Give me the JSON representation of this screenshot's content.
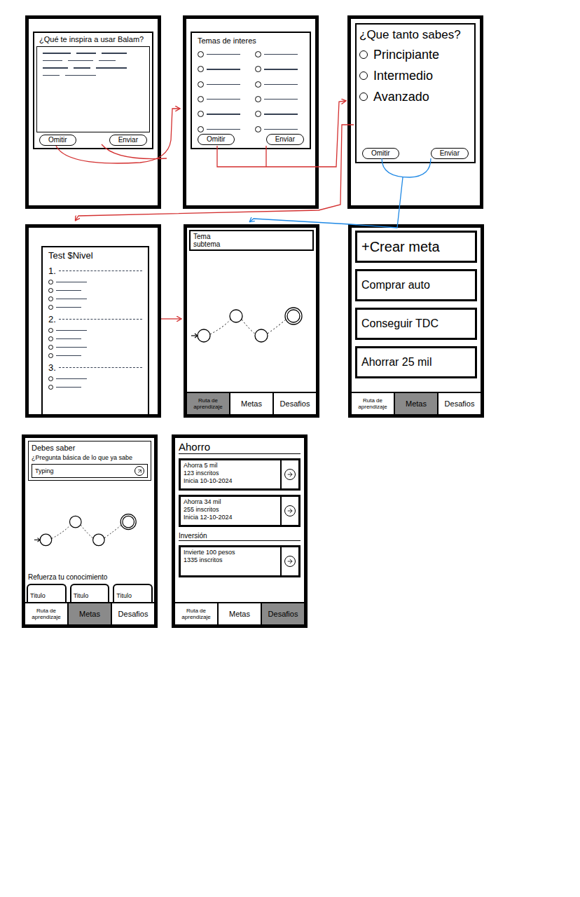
{
  "screens": [
    {
      "kind": "inspiration",
      "title": "¿Qué te inspira a usar Balam?",
      "buttons": [
        "Omitir",
        "Enviar"
      ]
    },
    {
      "kind": "topics",
      "title": "Temas de interes",
      "options": [
        {
          "selected": false
        },
        {
          "selected": false
        },
        {
          "selected": false
        },
        {
          "selected": false
        },
        {
          "selected": false
        },
        {
          "selected": false
        },
        {
          "selected": false
        },
        {
          "selected": false
        },
        {
          "selected": false
        },
        {
          "selected": false
        },
        {
          "selected": false
        },
        {
          "selected": false
        }
      ],
      "buttons": [
        "Omitir",
        "Enviar"
      ]
    },
    {
      "kind": "level",
      "title": "¿Que tanto sabes?",
      "options": [
        {
          "label": "Principiante",
          "selected": false
        },
        {
          "label": "Intermedio",
          "selected": false
        },
        {
          "label": "Avanzado",
          "selected": false
        }
      ],
      "buttons": [
        "Omitir",
        "Enviar"
      ]
    },
    {
      "kind": "test",
      "title": "Test $Nivel",
      "questions": [
        {
          "number": "1.",
          "options": [
            {
              "selected": false
            },
            {
              "selected": false
            },
            {
              "selected": false
            },
            {
              "selected": false
            }
          ]
        },
        {
          "number": "2.",
          "options": [
            {
              "selected": false
            },
            {
              "selected": false
            },
            {
              "selected": false
            },
            {
              "selected": false
            }
          ]
        },
        {
          "number": "3.",
          "options": [
            {
              "selected": false
            },
            {
              "selected": false
            }
          ]
        }
      ]
    },
    {
      "kind": "path",
      "header": {
        "title": "Tema",
        "subtitle": "subtema"
      },
      "nodes": [
        {
          "current": false
        },
        {
          "current": false
        },
        {
          "current": false
        },
        {
          "current": true
        }
      ],
      "tabs": [
        {
          "label": "Ruta de aprendizaje",
          "selected": true
        },
        {
          "label": "Metas",
          "selected": false
        },
        {
          "label": "Desafios",
          "selected": false
        }
      ]
    },
    {
      "kind": "goals",
      "items": [
        {
          "label": "+Crear meta",
          "kind": "action"
        },
        {
          "label": "Comprar auto",
          "kind": "goal"
        },
        {
          "label": "Conseguir TDC",
          "kind": "goal"
        },
        {
          "label": "Ahorrar 25 mil",
          "kind": "goal"
        }
      ],
      "tabs": [
        {
          "label": "Ruta de aprendizaje",
          "selected": false
        },
        {
          "label": "Metas",
          "selected": true
        },
        {
          "label": "Desafios",
          "selected": false
        }
      ]
    },
    {
      "kind": "lesson",
      "prompt": {
        "title": "Debes saber",
        "question": "¿Pregunta básica de lo que ya sabe",
        "input": "Typing"
      },
      "nodes": [
        {
          "current": false
        },
        {
          "current": false
        },
        {
          "current": false
        },
        {
          "current": true
        }
      ],
      "reinforce": {
        "title": "Refuerza tu conocimiento",
        "cards": [
          "Titulo",
          "Titulo",
          "Titulo"
        ]
      },
      "tabs": [
        {
          "label": "Ruta de aprendizaje",
          "selected": false
        },
        {
          "label": "Metas",
          "selected": true
        },
        {
          "label": "Desafios",
          "selected": false
        }
      ]
    },
    {
      "kind": "challenges",
      "groups": [
        {
          "heading": "Ahorro",
          "cards": [
            {
              "name": "Ahorra 5 mil",
              "enrolled": "123 inscritos",
              "start": "Inicia 10-10-2024"
            },
            {
              "name": "Ahorra 34 mil",
              "enrolled": "255 inscritos",
              "start": "Inicia 12-10-2024"
            }
          ]
        },
        {
          "heading": "Inversión",
          "cards": [
            {
              "name": "Invierte 100 pesos",
              "enrolled": "1335 inscritos"
            }
          ]
        }
      ],
      "tabs": [
        {
          "label": "Ruta de aprendizaje",
          "selected": false
        },
        {
          "label": "Metas",
          "selected": false
        },
        {
          "label": "Desafios",
          "selected": true
        }
      ]
    }
  ],
  "connectors": [
    {
      "from": 1,
      "to": 2,
      "color": "#d32f2f"
    },
    {
      "from": 2,
      "to": 3,
      "color": "#d32f2f"
    },
    {
      "from": 3,
      "to": 4,
      "color": "#d32f2f"
    },
    {
      "from": 4,
      "to": 5,
      "color": "#d32f2f"
    },
    {
      "from": 3,
      "to": 5,
      "color": "#1e88e5"
    }
  ]
}
